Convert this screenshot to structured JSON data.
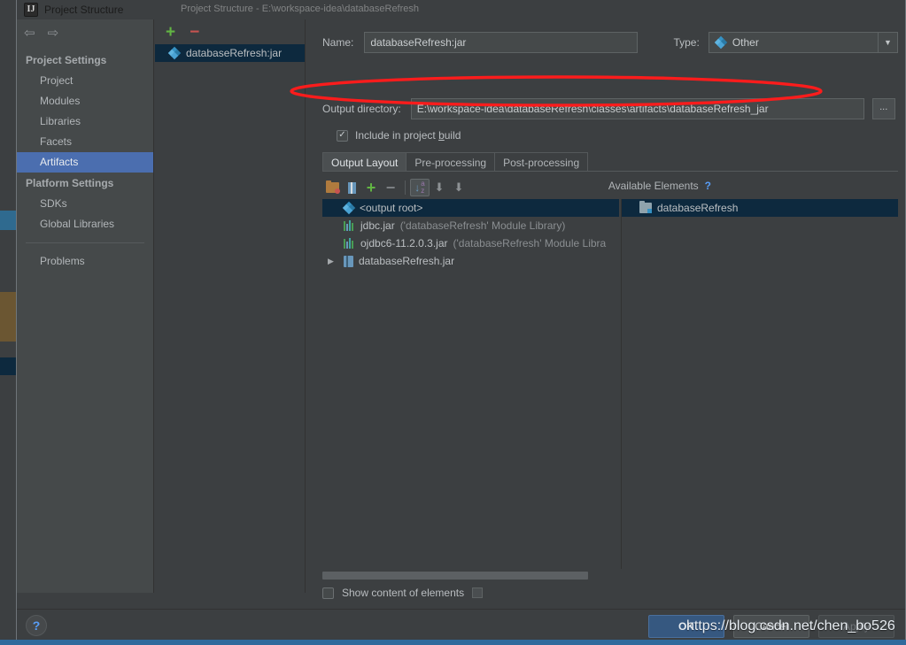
{
  "window": {
    "title": "Project Structure",
    "title_icon": "intellij-idea-icon",
    "ghost_title": "Project Structure - E:\\workspace-idea\\databaseRefresh",
    "close_label": "✖"
  },
  "sidebar": {
    "nav": {
      "back": "⇦",
      "forward": "⇨"
    },
    "groups": [
      {
        "label": "Project Settings",
        "items": [
          {
            "label": "Project",
            "selected": false
          },
          {
            "label": "Modules",
            "selected": false
          },
          {
            "label": "Libraries",
            "selected": false
          },
          {
            "label": "Facets",
            "selected": false
          },
          {
            "label": "Artifacts",
            "selected": true
          }
        ]
      },
      {
        "label": "Platform Settings",
        "items": [
          {
            "label": "SDKs",
            "selected": false
          },
          {
            "label": "Global Libraries",
            "selected": false
          }
        ]
      }
    ],
    "extra": [
      {
        "label": "Problems",
        "selected": false
      }
    ]
  },
  "artifacts": {
    "toolbar": {
      "add": "+",
      "remove": "−"
    },
    "items": [
      {
        "label": "databaseRefresh:jar",
        "icon": "artifact-diamond-icon",
        "selected": true
      }
    ]
  },
  "editor": {
    "name_label": "Name:",
    "name_value": "databaseRefresh:jar",
    "type_label": "Type:",
    "type_value": "Other",
    "type_icon": "artifact-diamond-icon",
    "output_label": "Output directory:",
    "output_value": "E:\\workspace-idea\\databaseRefresh\\classes\\artifacts\\databaseRefresh_jar",
    "browse_label": "...",
    "include_checkbox": {
      "label_pre": "Include in project ",
      "label_underlined": "b",
      "label_post": "uild",
      "checked": true,
      "check_glyph": "✓"
    },
    "tabs": [
      {
        "label": "Output Layout",
        "active": true
      },
      {
        "label": "Pre-processing",
        "active": false
      },
      {
        "label": "Post-processing",
        "active": false
      }
    ],
    "panel_toolbar": [
      {
        "name": "add-directory-icon",
        "type": "folder-red"
      },
      {
        "name": "add-archive-icon",
        "type": "archive"
      },
      {
        "name": "add-element-icon",
        "type": "plus"
      },
      {
        "name": "remove-element-icon",
        "type": "minus"
      },
      {
        "name": "sort-alphabetically-icon",
        "type": "sortaz",
        "active": true
      },
      {
        "name": "move-up-icon",
        "type": "arrow-up"
      },
      {
        "name": "move-down-icon",
        "type": "arrow-down"
      }
    ],
    "available_elements_label": "Available Elements",
    "available_help": "?",
    "output_tree": [
      {
        "indent": 0,
        "twisty": "",
        "icon": "artifact-diamond-icon",
        "label": "<output root>",
        "note": "",
        "selected": true
      },
      {
        "indent": 1,
        "twisty": "",
        "icon": "module-library-icon",
        "label": "jdbc.jar",
        "note": "('databaseRefresh' Module Library)",
        "selected": false
      },
      {
        "indent": 1,
        "twisty": "",
        "icon": "module-library-icon",
        "label": "ojdbc6-11.2.0.3.jar",
        "note": "('databaseRefresh' Module Libra",
        "selected": false
      },
      {
        "indent": 0,
        "twisty": "▶",
        "icon": "jar-icon",
        "label": "databaseRefresh.jar",
        "note": "",
        "selected": false
      }
    ],
    "available_tree": [
      {
        "indent": 0,
        "icon": "module-icon",
        "label": "databaseRefresh",
        "selected": true
      }
    ],
    "show_content": {
      "label": "Show content of elements",
      "checked": false
    }
  },
  "footer": {
    "help_label": "?",
    "buttons": [
      {
        "label": "OK",
        "style": "primary"
      },
      {
        "label": "Cancel",
        "style": "normal"
      },
      {
        "label": "Apply",
        "style": "disabled"
      }
    ]
  },
  "annotation": {
    "shape": "red-ellipse",
    "color": "#fb1c1c",
    "target": "output-directory-row"
  },
  "watermark": {
    "text": "https://blog.csdn.net/chen_bo526"
  }
}
